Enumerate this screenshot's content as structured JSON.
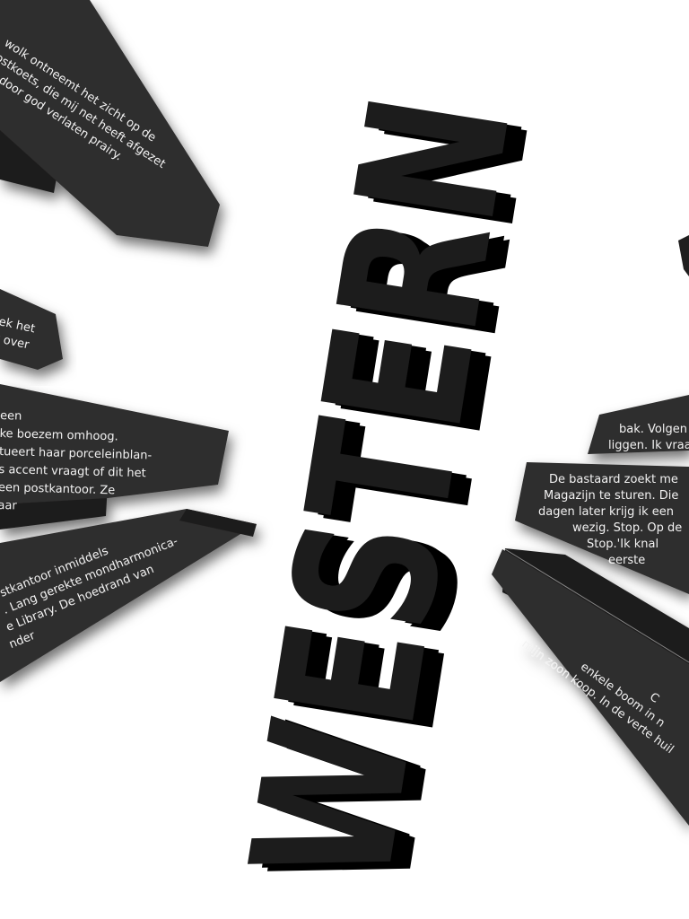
{
  "title": "WESTERN",
  "colors": {
    "panel": "#2e2d2d",
    "panel_dark": "#1f1e1e",
    "text": "#f2f2f2",
    "title": "#1a1a1a",
    "background": "#ffffff"
  },
  "panels": [
    {
      "lines": [
        "wolk ontneemt het zicht op de",
        "postkoets, die mij net heeft afgezet",
        "n dit door god verlaten prairy."
      ]
    },
    {
      "lines": [
        "ek het",
        "t over"
      ]
    },
    {
      "lines": [
        "een",
        "ke boezem omhoog.",
        "tueert haar porceleinblan-",
        "s accent vraagt of dit het",
        " een postkantoor. Ze",
        "aar"
      ]
    },
    {
      "lines": [
        "stkantoor inmiddels",
        ". Lang gerekte mondharmonica-",
        "e Library. De hoedrand van",
        "nder"
      ]
    },
    {
      "lines": [
        "bak. Volgen",
        "liggen. Ik vraa"
      ]
    },
    {
      "lines": [
        "De bastaard zoekt me",
        "Magazijn te sturen. Die",
        "dagen later krijg ik een",
        "wezig. Stop. Op de",
        "Stop.'Ik knal",
        "eerste"
      ]
    },
    {
      "lines": [
        "C",
        "enkele boom in n",
        "mijn zoon koop. In de verte huil"
      ]
    }
  ]
}
